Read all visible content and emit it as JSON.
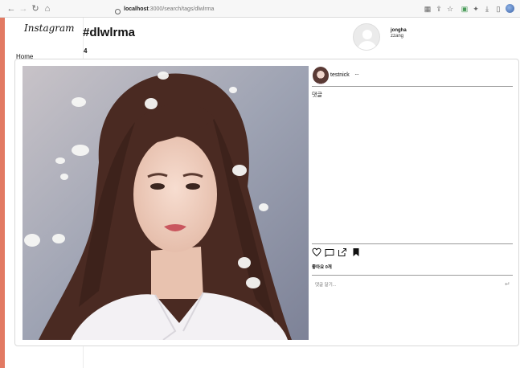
{
  "browser": {
    "url_host": "localhost",
    "url_path": ":3000/search/tags/dlwlrma"
  },
  "sidebar": {
    "logo": "Instagram",
    "home_label": "Home"
  },
  "header": {
    "tag_title": "#dlwlrma",
    "post_count": "4"
  },
  "current_user": {
    "name": "jongha",
    "subname": "zzang"
  },
  "post": {
    "author": "testnick",
    "more": "···",
    "comment": "댓글",
    "likes": "좋아요 0개",
    "comment_placeholder": "댓글 달기...",
    "enter_icon": "↵"
  }
}
